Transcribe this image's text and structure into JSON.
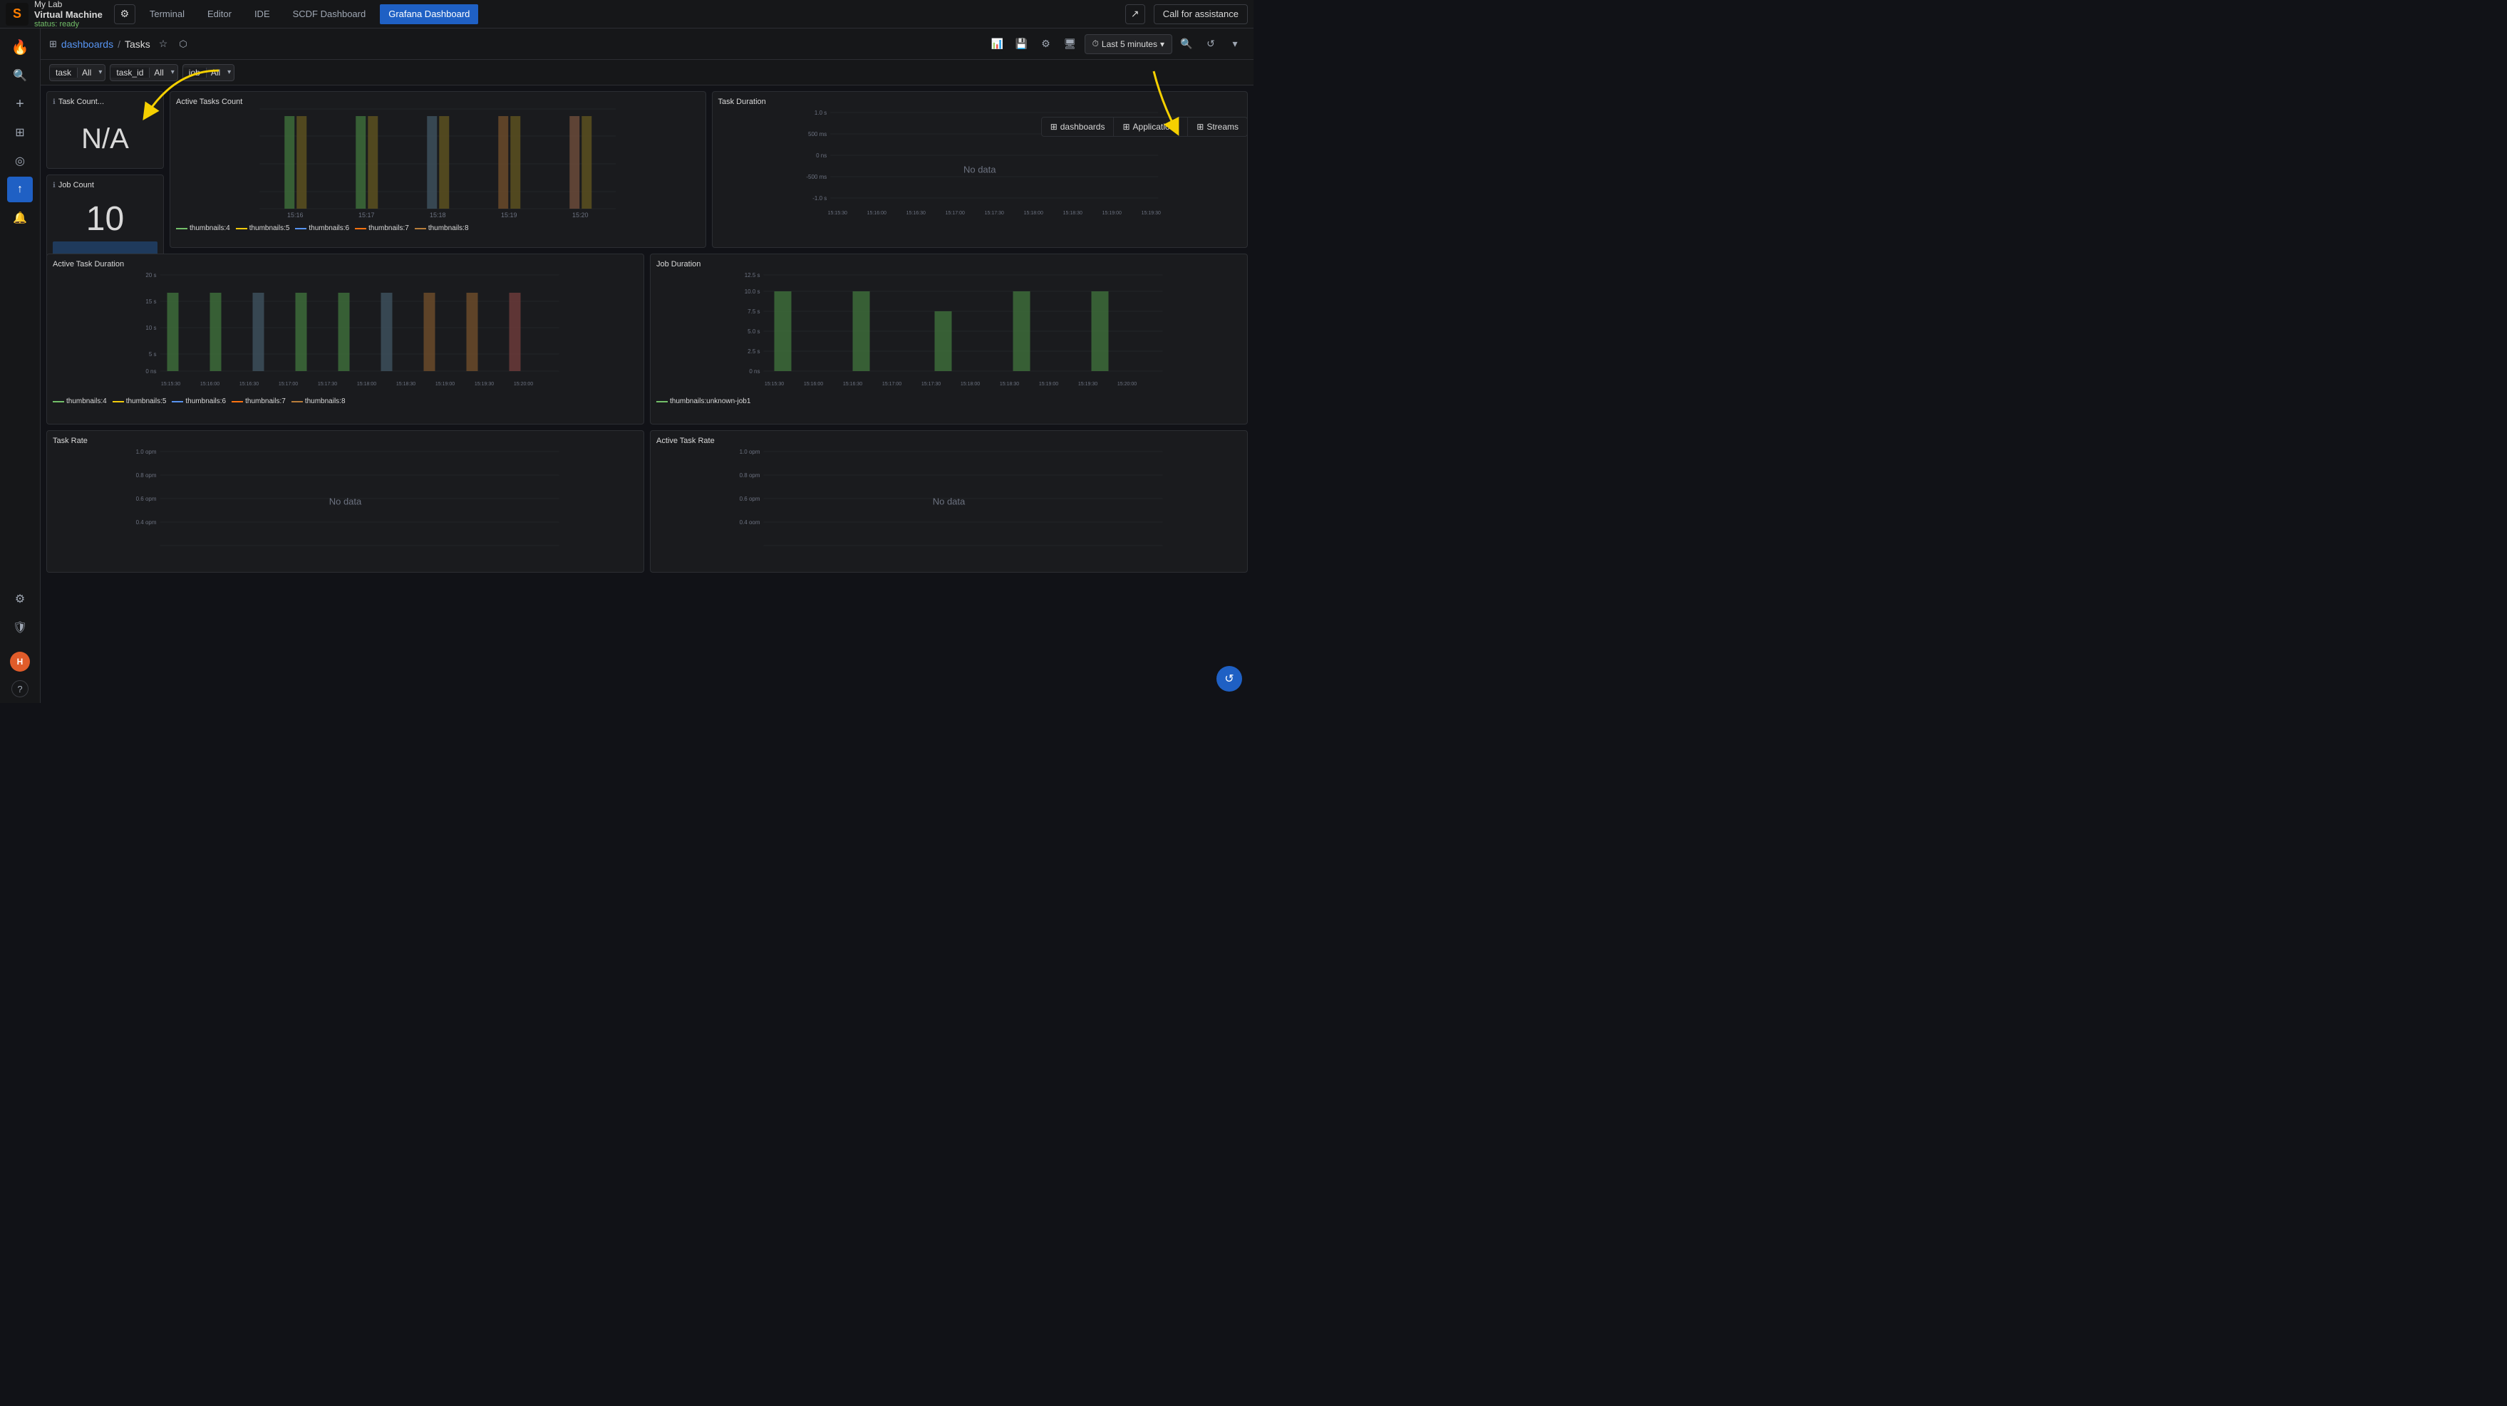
{
  "topbar": {
    "lab_label": "My Lab",
    "vm_label": "Virtual Machine",
    "vm_status": "status: ready",
    "gear_icon": "⚙",
    "nav_items": [
      {
        "label": "Terminal",
        "active": false
      },
      {
        "label": "Editor",
        "active": false
      },
      {
        "label": "IDE",
        "active": false
      },
      {
        "label": "SCDF Dashboard",
        "active": false
      },
      {
        "label": "Grafana Dashboard",
        "active": true
      }
    ],
    "ext_icon": "↗",
    "call_assist_label": "Call for assistance"
  },
  "sidebar": {
    "icons": [
      {
        "name": "grafana-logo",
        "symbol": "🔥",
        "active": false
      },
      {
        "name": "search",
        "symbol": "🔍",
        "active": false
      },
      {
        "name": "plus",
        "symbol": "+",
        "active": false
      },
      {
        "name": "grid",
        "symbol": "⊞",
        "active": false
      },
      {
        "name": "compass",
        "symbol": "◎",
        "active": false
      },
      {
        "name": "upload",
        "symbol": "↑",
        "active": true
      },
      {
        "name": "bell",
        "symbol": "🔔",
        "active": false
      },
      {
        "name": "gear",
        "symbol": "⚙",
        "active": false
      },
      {
        "name": "shield",
        "symbol": "🛡",
        "active": false
      }
    ],
    "bottom_icons": [
      {
        "name": "avatar",
        "symbol": "H"
      },
      {
        "name": "help",
        "symbol": "?"
      }
    ]
  },
  "dashboard": {
    "breadcrumb_icon": "⊞",
    "breadcrumb_root": "dashboards",
    "breadcrumb_separator": "/",
    "breadcrumb_current": "Tasks",
    "star_icon": "☆",
    "share_icon": "⬡",
    "toolbar_icons": [
      "📊",
      "💾",
      "⚙",
      "🖥",
      "⏱"
    ],
    "time_range": "Last 5 minutes",
    "time_icon": "⏱",
    "zoom_in_icon": "🔍",
    "refresh_icon": "↺",
    "more_icon": "▾",
    "top_right_tabs": [
      {
        "icon": "⊞",
        "label": "dashboards"
      },
      {
        "icon": "⊞",
        "label": "Applications"
      },
      {
        "icon": "⊞",
        "label": "Streams"
      }
    ]
  },
  "filters": [
    {
      "label": "task",
      "value": "All"
    },
    {
      "label": "task_id",
      "value": "All"
    },
    {
      "label": "job",
      "value": "All"
    }
  ],
  "panels": {
    "task_count": {
      "title": "Task Count...",
      "value": "N/A"
    },
    "job_count": {
      "title": "Job Count",
      "value": "10"
    },
    "active_tasks_count": {
      "title": "Active Tasks Count",
      "times": [
        "15:16",
        "15:17",
        "15:18",
        "15:19",
        "15:20"
      ],
      "legend": [
        {
          "label": "thumbnails:4",
          "color": "#73bf69"
        },
        {
          "label": "thumbnails:5",
          "color": "#f2cc0c"
        },
        {
          "label": "thumbnails:6",
          "color": "#5794f2"
        },
        {
          "label": "thumbnails:7",
          "color": "#ff7310"
        },
        {
          "label": "thumbnails:8",
          "color": "#b87d3b"
        }
      ]
    },
    "task_duration": {
      "title": "Task Duration",
      "times": [
        "15:15:30",
        "15:16:00",
        "15:16:30",
        "15:17:00",
        "15:17:30",
        "15:18:00",
        "15:18:30",
        "15:19:00",
        "15:19:30",
        "15:20:00"
      ],
      "y_labels": [
        "1.0 s",
        "500 ms",
        "0 ns",
        "-500 ms",
        "-1.0 s"
      ],
      "no_data": "No data"
    },
    "active_task_duration": {
      "title": "Active Task Duration",
      "y_labels": [
        "20 s",
        "15 s",
        "10 s",
        "5 s",
        "0 ns"
      ],
      "times": [
        "15:15:30",
        "15:16:00",
        "15:16:30",
        "15:17:00",
        "15:17:30",
        "15:18:00",
        "15:18:30",
        "15:19:00",
        "15:19:30",
        "15:20:00"
      ],
      "legend": [
        {
          "label": "thumbnails:4",
          "color": "#73bf69"
        },
        {
          "label": "thumbnails:5",
          "color": "#f2cc0c"
        },
        {
          "label": "thumbnails:6",
          "color": "#5794f2"
        },
        {
          "label": "thumbnails:7",
          "color": "#ff7310"
        },
        {
          "label": "thumbnails:8",
          "color": "#b87d3b"
        }
      ]
    },
    "job_duration": {
      "title": "Job Duration",
      "y_labels": [
        "12.5 s",
        "10.0 s",
        "7.5 s",
        "5.0 s",
        "2.5 s",
        "0 ns"
      ],
      "times": [
        "15:15:30",
        "15:16:00",
        "15:16:30",
        "15:17:00",
        "15:17:30",
        "15:18:00",
        "15:18:30",
        "15:19:00",
        "15:19:30",
        "15:20:00"
      ],
      "legend": [
        {
          "label": "thumbnails:unknown-job1",
          "color": "#73bf69"
        }
      ]
    },
    "task_rate": {
      "title": "Task Rate",
      "y_labels": [
        "1.0 opm",
        "0.8 opm",
        "0.6 opm",
        "0.4 opm"
      ],
      "no_data": "No data"
    },
    "active_task_rate": {
      "title": "Active Task Rate",
      "y_labels": [
        "1.0 opm",
        "0.8 opm",
        "0.6 opm",
        "0.4 oom"
      ],
      "no_data": "No data"
    }
  },
  "arrows": {
    "arrow1_note": "arrow pointing to breadcrumb area",
    "arrow2_note": "arrow pointing to top-right tabs"
  }
}
